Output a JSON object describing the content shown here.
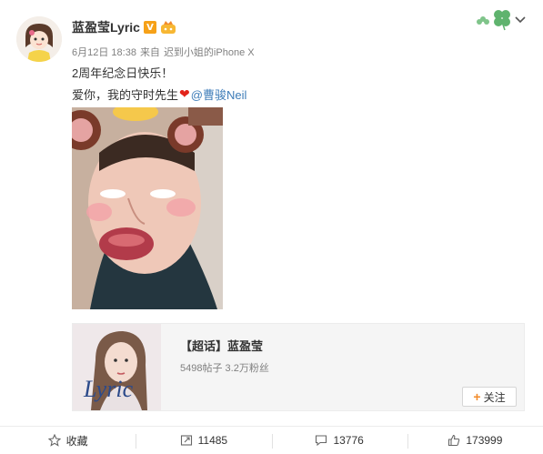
{
  "post": {
    "author": "蓝盈莹Lyric",
    "verified_badge": "V",
    "date": "6月12日 18:38",
    "source_prefix": "来自",
    "source": "迟到小姐的iPhone X",
    "line1": "2周年纪念日快乐！",
    "line2_text": "爱你，我的守时先生",
    "line2_mention": "@曹骏Neil"
  },
  "card": {
    "title": "【超话】蓝盈莹",
    "stats": "5498帖子 3.2万粉丝",
    "follow_label": "关注",
    "image_caption": "Lyric"
  },
  "toolbar": {
    "favorite_label": "收藏",
    "repost_count": "11485",
    "comment_count": "13776",
    "like_count": "173999"
  },
  "colors": {
    "accent": "#f28b2a",
    "link": "#3d7cb8",
    "badge": "#f6a118",
    "heart": "#e2231a"
  }
}
